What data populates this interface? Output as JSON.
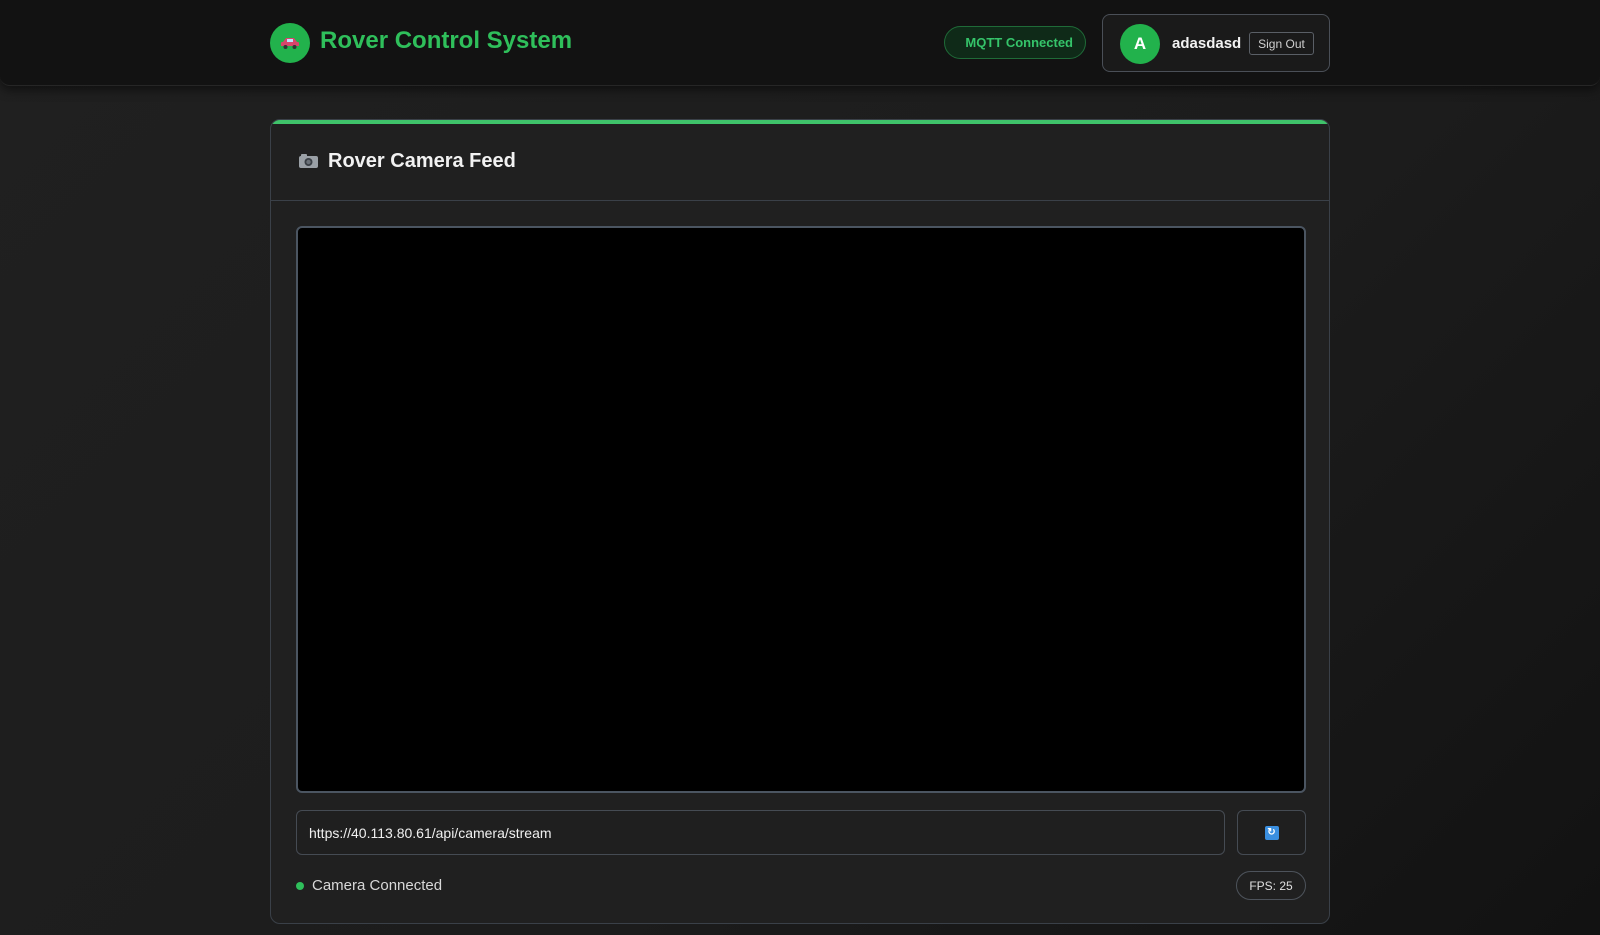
{
  "header": {
    "logo_icon": "car-icon",
    "title": "Rover Control System",
    "mqtt_status": "MQTT Connected",
    "user": {
      "avatar_initial": "A",
      "username": "adasdasd",
      "signout_label": "Sign Out"
    }
  },
  "camera_panel": {
    "icon": "camera-icon",
    "title": "Rover Camera Feed",
    "stream_url": "https://40.113.80.61/api/camera/stream",
    "refresh_icon": "refresh-icon",
    "status": "Camera Connected",
    "fps": "FPS: 25"
  },
  "colors": {
    "accent": "#2fbf5b",
    "background": "#1c1c1c",
    "panel": "#202020",
    "video": "#000000"
  }
}
